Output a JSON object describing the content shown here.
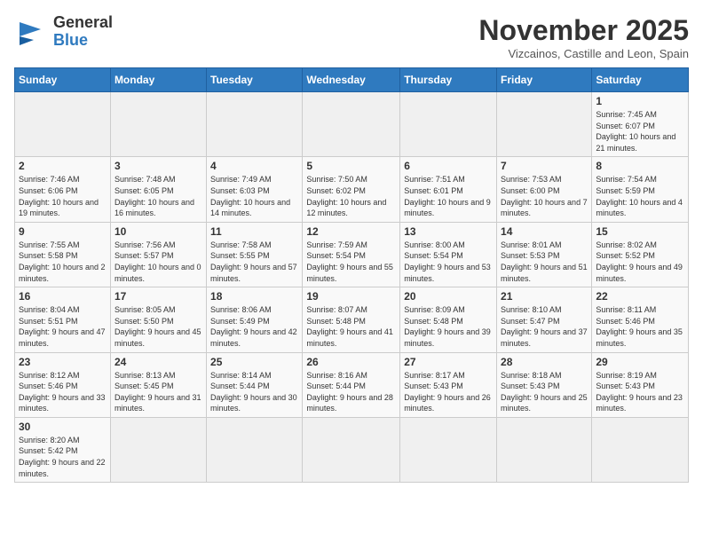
{
  "header": {
    "logo_general": "General",
    "logo_blue": "Blue",
    "month_year": "November 2025",
    "location": "Vizcainos, Castille and Leon, Spain"
  },
  "days_of_week": [
    "Sunday",
    "Monday",
    "Tuesday",
    "Wednesday",
    "Thursday",
    "Friday",
    "Saturday"
  ],
  "weeks": [
    [
      {
        "day": "",
        "info": ""
      },
      {
        "day": "",
        "info": ""
      },
      {
        "day": "",
        "info": ""
      },
      {
        "day": "",
        "info": ""
      },
      {
        "day": "",
        "info": ""
      },
      {
        "day": "",
        "info": ""
      },
      {
        "day": "1",
        "info": "Sunrise: 7:45 AM\nSunset: 6:07 PM\nDaylight: 10 hours and 21 minutes."
      }
    ],
    [
      {
        "day": "2",
        "info": "Sunrise: 7:46 AM\nSunset: 6:06 PM\nDaylight: 10 hours and 19 minutes."
      },
      {
        "day": "3",
        "info": "Sunrise: 7:48 AM\nSunset: 6:05 PM\nDaylight: 10 hours and 16 minutes."
      },
      {
        "day": "4",
        "info": "Sunrise: 7:49 AM\nSunset: 6:03 PM\nDaylight: 10 hours and 14 minutes."
      },
      {
        "day": "5",
        "info": "Sunrise: 7:50 AM\nSunset: 6:02 PM\nDaylight: 10 hours and 12 minutes."
      },
      {
        "day": "6",
        "info": "Sunrise: 7:51 AM\nSunset: 6:01 PM\nDaylight: 10 hours and 9 minutes."
      },
      {
        "day": "7",
        "info": "Sunrise: 7:53 AM\nSunset: 6:00 PM\nDaylight: 10 hours and 7 minutes."
      },
      {
        "day": "8",
        "info": "Sunrise: 7:54 AM\nSunset: 5:59 PM\nDaylight: 10 hours and 4 minutes."
      }
    ],
    [
      {
        "day": "9",
        "info": "Sunrise: 7:55 AM\nSunset: 5:58 PM\nDaylight: 10 hours and 2 minutes."
      },
      {
        "day": "10",
        "info": "Sunrise: 7:56 AM\nSunset: 5:57 PM\nDaylight: 10 hours and 0 minutes."
      },
      {
        "day": "11",
        "info": "Sunrise: 7:58 AM\nSunset: 5:55 PM\nDaylight: 9 hours and 57 minutes."
      },
      {
        "day": "12",
        "info": "Sunrise: 7:59 AM\nSunset: 5:54 PM\nDaylight: 9 hours and 55 minutes."
      },
      {
        "day": "13",
        "info": "Sunrise: 8:00 AM\nSunset: 5:54 PM\nDaylight: 9 hours and 53 minutes."
      },
      {
        "day": "14",
        "info": "Sunrise: 8:01 AM\nSunset: 5:53 PM\nDaylight: 9 hours and 51 minutes."
      },
      {
        "day": "15",
        "info": "Sunrise: 8:02 AM\nSunset: 5:52 PM\nDaylight: 9 hours and 49 minutes."
      }
    ],
    [
      {
        "day": "16",
        "info": "Sunrise: 8:04 AM\nSunset: 5:51 PM\nDaylight: 9 hours and 47 minutes."
      },
      {
        "day": "17",
        "info": "Sunrise: 8:05 AM\nSunset: 5:50 PM\nDaylight: 9 hours and 45 minutes."
      },
      {
        "day": "18",
        "info": "Sunrise: 8:06 AM\nSunset: 5:49 PM\nDaylight: 9 hours and 42 minutes."
      },
      {
        "day": "19",
        "info": "Sunrise: 8:07 AM\nSunset: 5:48 PM\nDaylight: 9 hours and 41 minutes."
      },
      {
        "day": "20",
        "info": "Sunrise: 8:09 AM\nSunset: 5:48 PM\nDaylight: 9 hours and 39 minutes."
      },
      {
        "day": "21",
        "info": "Sunrise: 8:10 AM\nSunset: 5:47 PM\nDaylight: 9 hours and 37 minutes."
      },
      {
        "day": "22",
        "info": "Sunrise: 8:11 AM\nSunset: 5:46 PM\nDaylight: 9 hours and 35 minutes."
      }
    ],
    [
      {
        "day": "23",
        "info": "Sunrise: 8:12 AM\nSunset: 5:46 PM\nDaylight: 9 hours and 33 minutes."
      },
      {
        "day": "24",
        "info": "Sunrise: 8:13 AM\nSunset: 5:45 PM\nDaylight: 9 hours and 31 minutes."
      },
      {
        "day": "25",
        "info": "Sunrise: 8:14 AM\nSunset: 5:44 PM\nDaylight: 9 hours and 30 minutes."
      },
      {
        "day": "26",
        "info": "Sunrise: 8:16 AM\nSunset: 5:44 PM\nDaylight: 9 hours and 28 minutes."
      },
      {
        "day": "27",
        "info": "Sunrise: 8:17 AM\nSunset: 5:43 PM\nDaylight: 9 hours and 26 minutes."
      },
      {
        "day": "28",
        "info": "Sunrise: 8:18 AM\nSunset: 5:43 PM\nDaylight: 9 hours and 25 minutes."
      },
      {
        "day": "29",
        "info": "Sunrise: 8:19 AM\nSunset: 5:43 PM\nDaylight: 9 hours and 23 minutes."
      }
    ],
    [
      {
        "day": "30",
        "info": "Sunrise: 8:20 AM\nSunset: 5:42 PM\nDaylight: 9 hours and 22 minutes."
      },
      {
        "day": "",
        "info": ""
      },
      {
        "day": "",
        "info": ""
      },
      {
        "day": "",
        "info": ""
      },
      {
        "day": "",
        "info": ""
      },
      {
        "day": "",
        "info": ""
      },
      {
        "day": "",
        "info": ""
      }
    ]
  ]
}
